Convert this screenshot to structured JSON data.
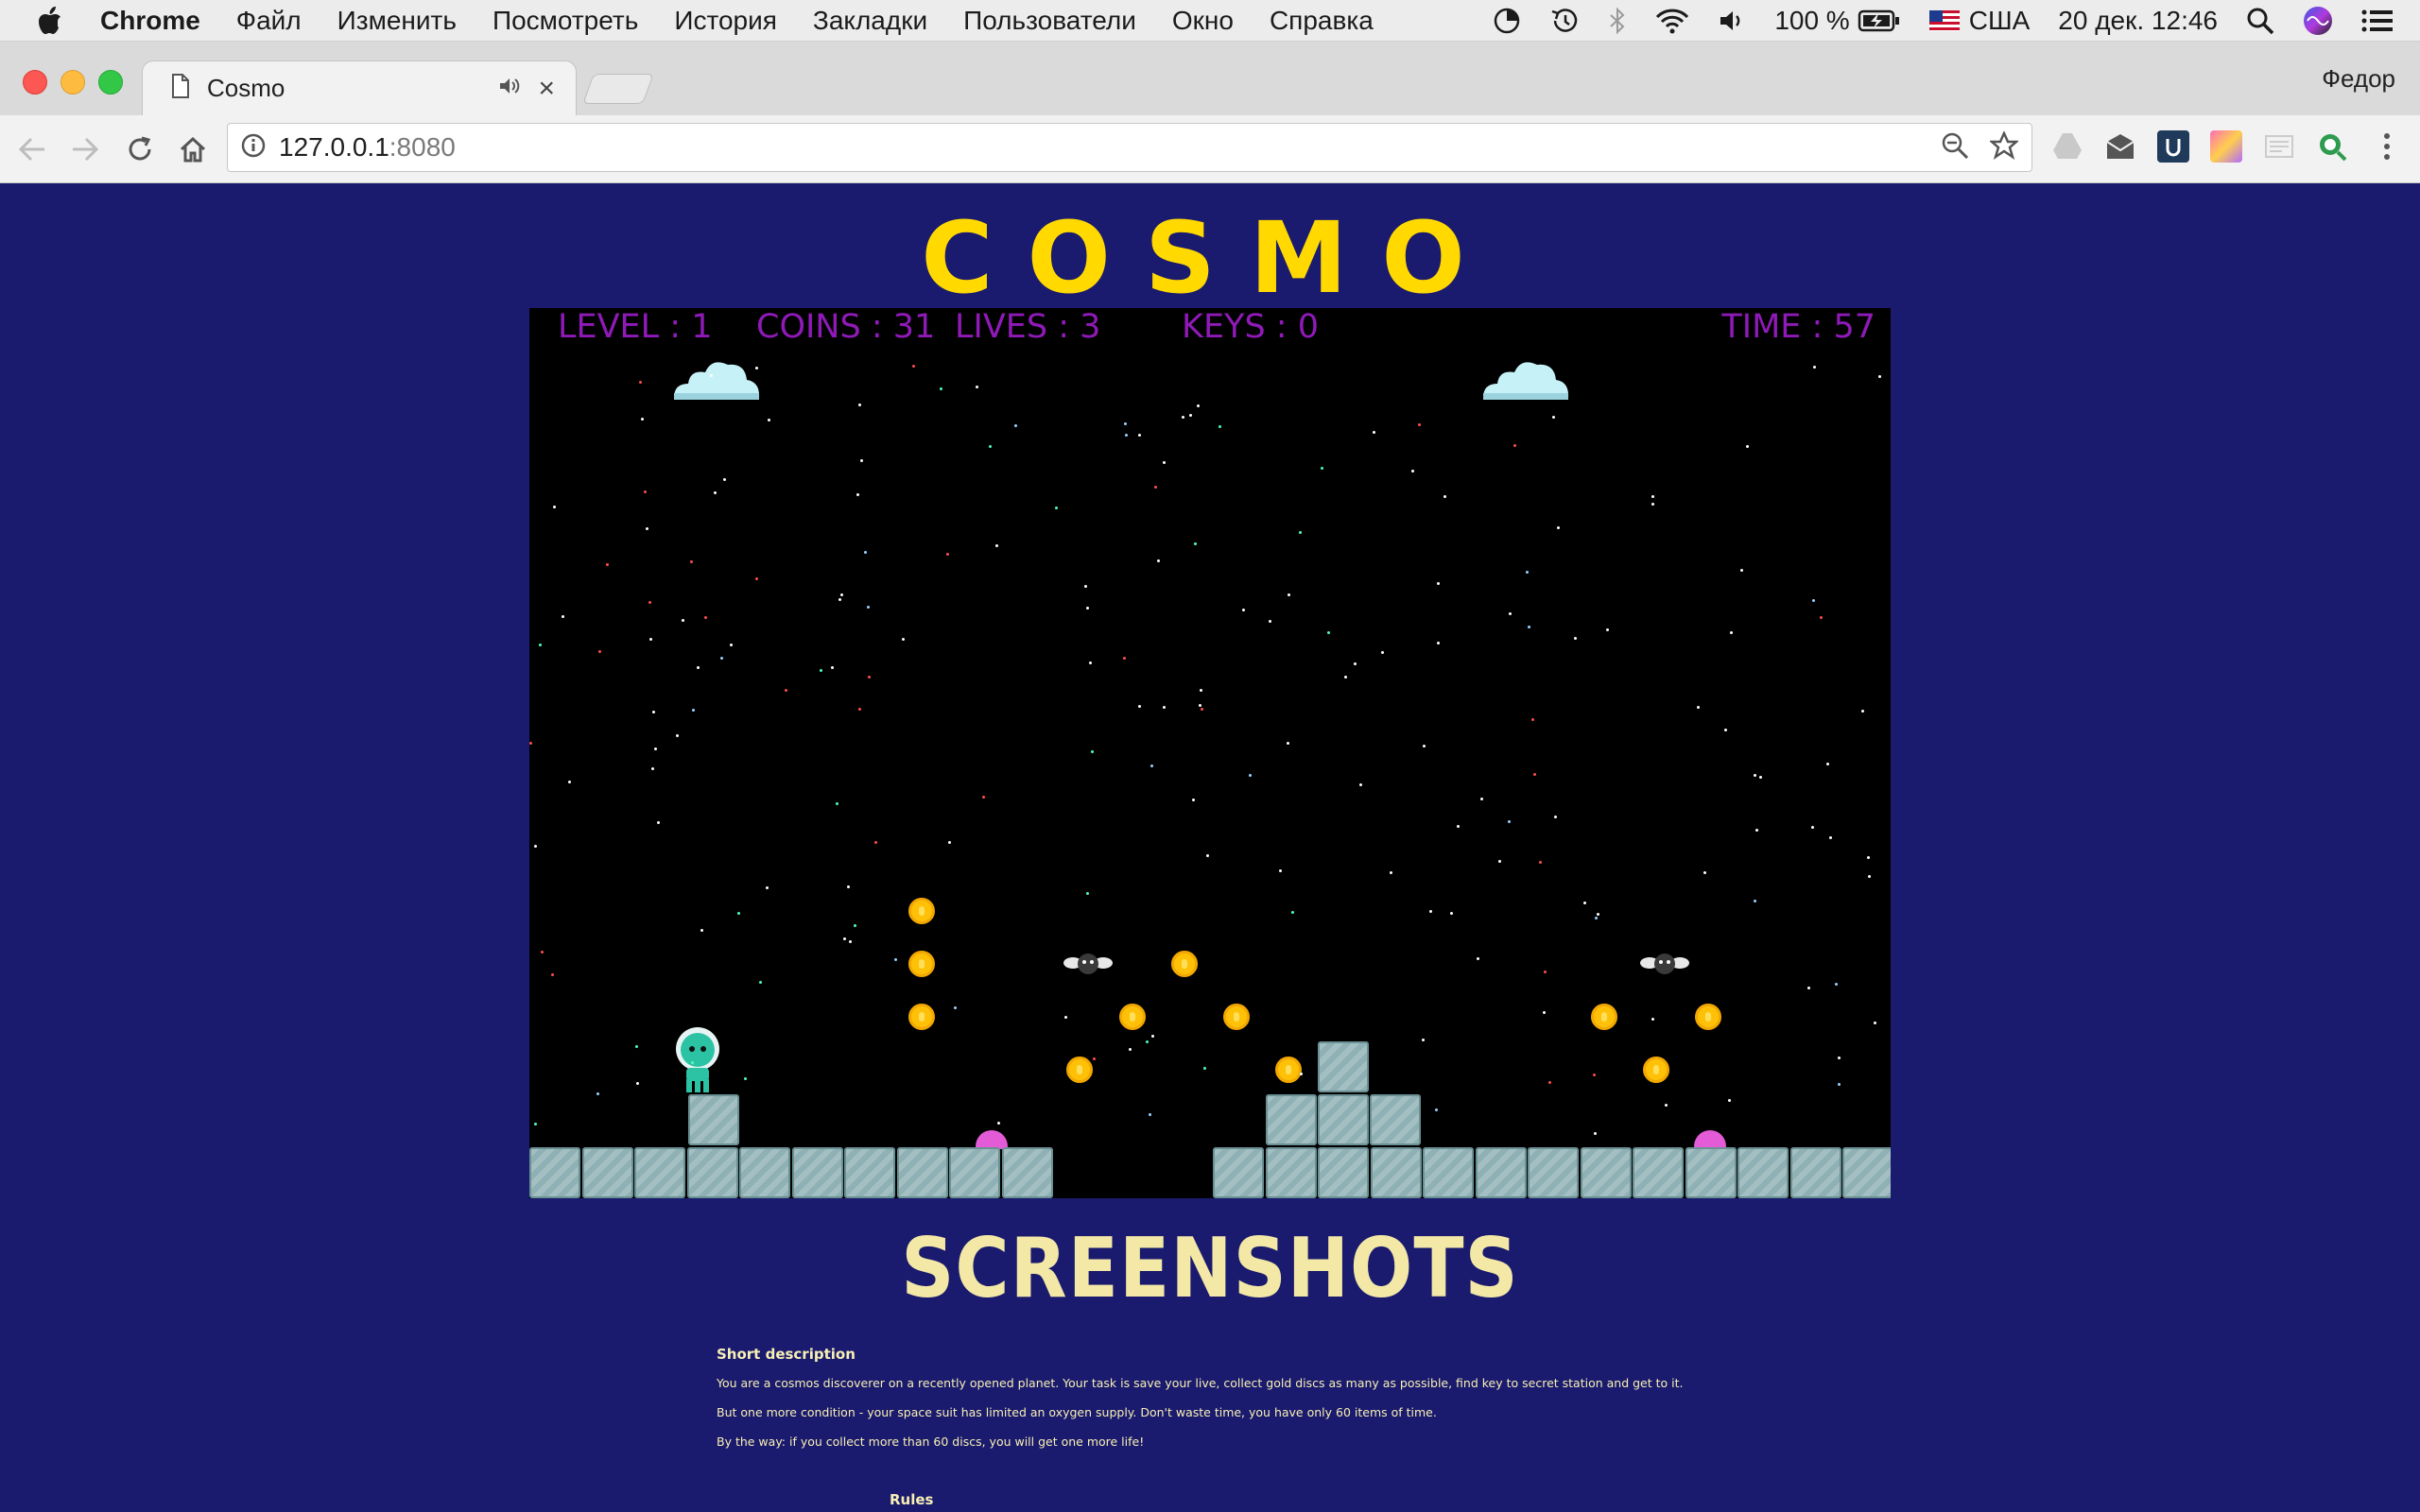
{
  "menubar": {
    "app_name": "Chrome",
    "items": [
      "Файл",
      "Изменить",
      "Посмотреть",
      "История",
      "Закладки",
      "Пользователи",
      "Окно",
      "Справка"
    ],
    "battery": "100 %",
    "input_source": "США",
    "clock": "20 дек.  12:46"
  },
  "browser": {
    "tab_title": "Cosmo",
    "profile_name": "Федор",
    "url_host": "127.0.0.1",
    "url_port": ":8080"
  },
  "page": {
    "title": "COSMO",
    "hud": {
      "level": "LEVEL : 1",
      "coins": "COINS : 31",
      "lives": "LIVES : 3",
      "keys": "KEYS : 0",
      "time": "TIME : 57"
    },
    "section_heading": "SCREENSHOTS",
    "description": {
      "title": "Short description",
      "p1": "You are a cosmos discoverer on a recently opened planet. Your task is save your live, collect gold discs as many as possible, find key to secret station and get to it.",
      "p2": "But one more condition - your space suit has limited an oxygen supply. Don't waste time, you have only 60 items of time.",
      "p3": "By the way: if you collect more than 60 discs, you will get one more life!"
    },
    "rules_title": "Rules"
  },
  "colors": {
    "page_background": "#1a1a6e",
    "title": "#ffd900",
    "hud": "#8f1ab8",
    "heading": "#f3e8a6"
  }
}
